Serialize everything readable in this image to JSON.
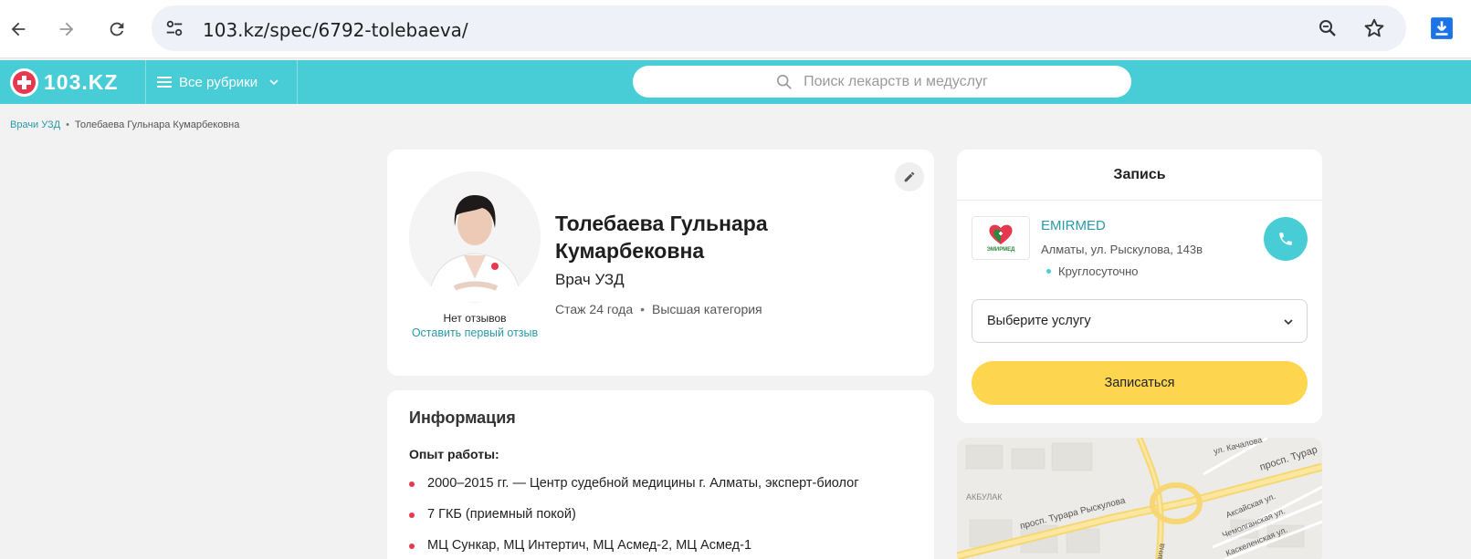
{
  "browser": {
    "url": "103.kz/spec/6792-tolebaeva/"
  },
  "site": {
    "logo_text": "103.KZ",
    "rubrics_label": "Все рубрики",
    "search_placeholder": "Поиск лекарств и медуслуг"
  },
  "breadcrumb": {
    "items": [
      "Врачи УЗД",
      "Толебаева Гульнара Кумарбековна"
    ]
  },
  "doctor": {
    "name": "Толебаева Гульнара Кумарбековна",
    "specialty": "Врач УЗД",
    "experience": "Стаж 24 года",
    "category": "Высшая категория",
    "reviews_text": "Нет отзывов",
    "leave_review": "Оставить первый отзыв"
  },
  "info": {
    "title": "Информация",
    "experience_title": "Опыт работы:",
    "experience_items": [
      "2000–2015 гг. — Центр судебной медицины г. Алматы, эксперт-биолог",
      "7 ГКБ (приемный покой)",
      "МЦ Сункар, МЦ Интертич, МЦ Асмед-2, МЦ Асмед-1"
    ]
  },
  "booking": {
    "title": "Запись",
    "clinic_name": "EMIRMED",
    "clinic_logo_text": "ЭМИРМЕД",
    "clinic_address": "Алматы, ул. Рыскулова, 143в",
    "clinic_hours": "Круглосуточно",
    "service_select": "Выберите услугу",
    "book_button": "Записаться"
  },
  "map": {
    "labels": [
      "ул. Качалова",
      "просп. Турар",
      "АКБУЛАК",
      "просп. Турара Рыскулова",
      "Аксайская ул.",
      "Чемолганская ул.",
      "Каскеленская ул.",
      "аина"
    ]
  },
  "colors": {
    "brand": "#48cdd6",
    "accent_red": "#e8384f",
    "button_yellow": "#fdd54f",
    "link": "#2a9aa8"
  }
}
